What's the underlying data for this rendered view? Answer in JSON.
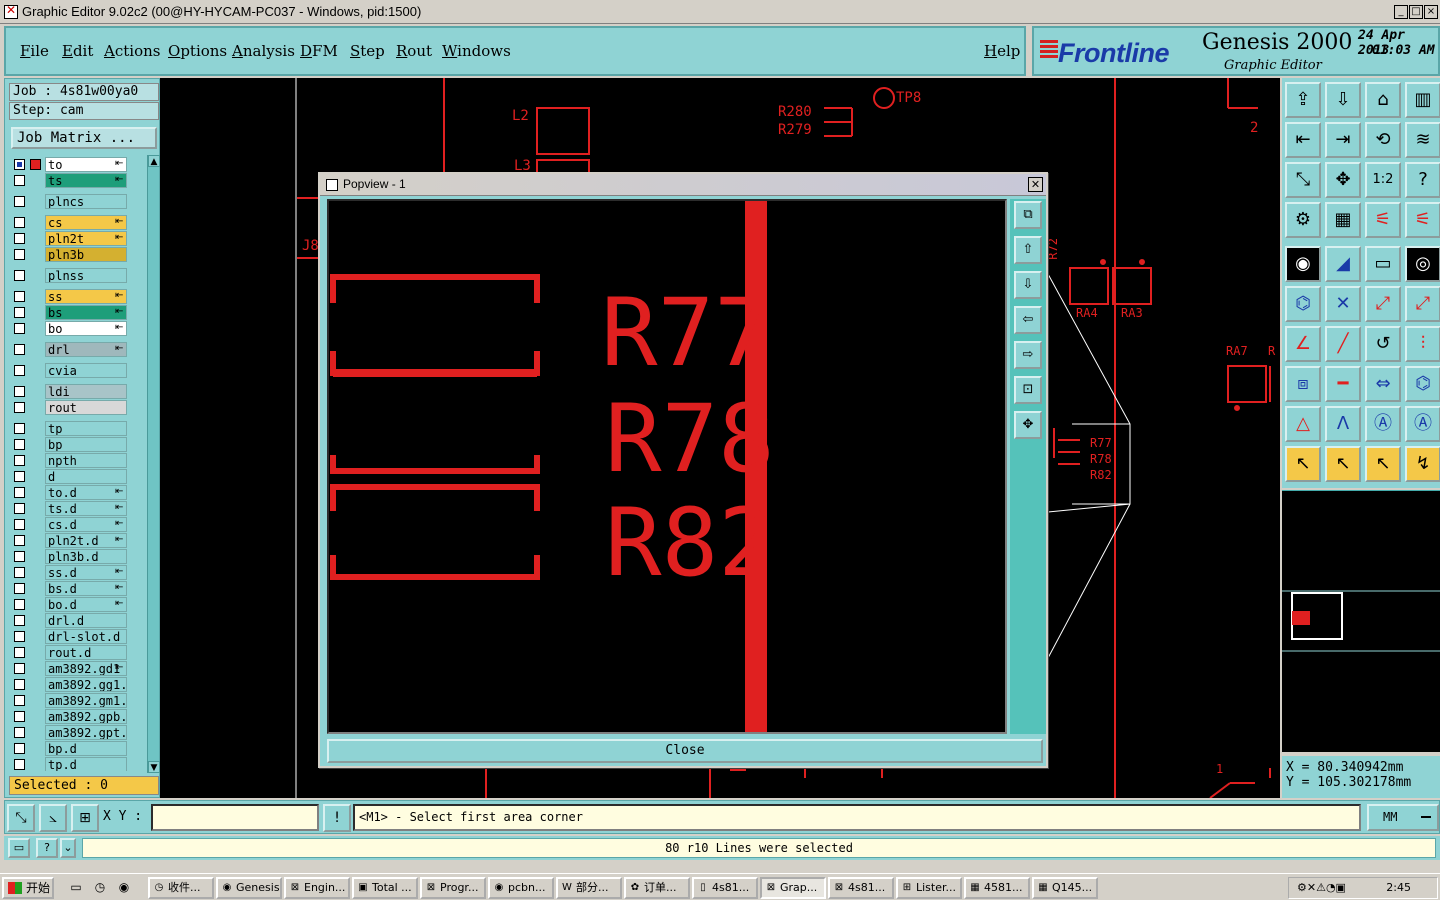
{
  "window": {
    "title": "Graphic Editor 9.02c2 (00@HY-HYCAM-PC037 - Windows, pid:1500)",
    "controls": [
      "_",
      "□",
      "×"
    ]
  },
  "menu": {
    "items": [
      "File",
      "Edit",
      "Actions",
      "Options",
      "Analysis",
      "DFM",
      "Step",
      "Rout",
      "Windows"
    ],
    "help": "Help"
  },
  "brand": {
    "logo": "Frontline",
    "product": "Genesis 2000",
    "subtitle": "Graphic Editor",
    "date": "24 Apr 2013",
    "time": "01:03 AM"
  },
  "left_panel": {
    "job": "Job : 4s81w00ya0",
    "step": "Step: cam",
    "job_matrix": "Job Matrix ...",
    "layers": [
      {
        "name": "to",
        "color": "#ffffff",
        "mark": "⇤"
      },
      {
        "name": "ts",
        "color": "#1e9e7a",
        "mark": "⇤"
      },
      {
        "name": "plncs",
        "color": "#8fd3d4",
        "mark": ""
      },
      {
        "name": "cs",
        "color": "#f4c848",
        "mark": "⇤"
      },
      {
        "name": "pln2t",
        "color": "#f4c848",
        "mark": "⇤"
      },
      {
        "name": "pln3b",
        "color": "#d4b030",
        "mark": ""
      },
      {
        "name": "plnss",
        "color": "#8fd3d4",
        "mark": ""
      },
      {
        "name": "ss",
        "color": "#f4c848",
        "mark": "⇤"
      },
      {
        "name": "bs",
        "color": "#1e9e7a",
        "mark": "⇤"
      },
      {
        "name": "bo",
        "color": "#ffffff",
        "mark": "⇤"
      },
      {
        "name": "drl",
        "color": "#9fb8bc",
        "mark": "⇤"
      },
      {
        "name": "cvia",
        "color": "#8fd3d4",
        "mark": ""
      },
      {
        "name": "ldi",
        "color": "#a8c4c8",
        "mark": ""
      },
      {
        "name": "rout",
        "color": "#d8d8d8",
        "mark": ""
      },
      {
        "name": "tp",
        "color": "#8fd3d4",
        "mark": ""
      },
      {
        "name": "bp",
        "color": "#8fd3d4",
        "mark": ""
      },
      {
        "name": "npth",
        "color": "#8fd3d4",
        "mark": ""
      },
      {
        "name": "d",
        "color": "#8fd3d4",
        "mark": ""
      },
      {
        "name": "to.d",
        "color": "#8fd3d4",
        "mark": "⇤"
      },
      {
        "name": "ts.d",
        "color": "#8fd3d4",
        "mark": "⇤"
      },
      {
        "name": "cs.d",
        "color": "#8fd3d4",
        "mark": "⇤"
      },
      {
        "name": "pln2t.d",
        "color": "#8fd3d4",
        "mark": "⇤"
      },
      {
        "name": "pln3b.d",
        "color": "#8fd3d4",
        "mark": ""
      },
      {
        "name": "ss.d",
        "color": "#8fd3d4",
        "mark": "⇤"
      },
      {
        "name": "bs.d",
        "color": "#8fd3d4",
        "mark": "⇤"
      },
      {
        "name": "bo.d",
        "color": "#8fd3d4",
        "mark": "⇤"
      },
      {
        "name": "drl.d",
        "color": "#8fd3d4",
        "mark": ""
      },
      {
        "name": "drl-slot.d",
        "color": "#8fd3d4",
        "mark": ""
      },
      {
        "name": "rout.d",
        "color": "#8fd3d4",
        "mark": ""
      },
      {
        "name": "am3892.gd1",
        "color": "#8fd3d4",
        "mark": "⇤"
      },
      {
        "name": "am3892.gg1.",
        "color": "#8fd3d4",
        "mark": ""
      },
      {
        "name": "am3892.gm1.",
        "color": "#8fd3d4",
        "mark": ""
      },
      {
        "name": "am3892.gpb.",
        "color": "#8fd3d4",
        "mark": ""
      },
      {
        "name": "am3892.gpt.",
        "color": "#8fd3d4",
        "mark": ""
      },
      {
        "name": "bp.d",
        "color": "#8fd3d4",
        "mark": ""
      },
      {
        "name": "tp.d",
        "color": "#8fd3d4",
        "mark": ""
      }
    ],
    "selected": "Selected : 0"
  },
  "canvas": {
    "labels": {
      "l2": "L2",
      "l3": "L3",
      "r280": "R280",
      "r279": "R279",
      "tp8": "TP8",
      "j8": "J8",
      "r72": "R72",
      "ra4": "RA4",
      "ra3": "RA3",
      "ra7": "RA7",
      "r": "R",
      "r77": "R77",
      "r78": "R78",
      "r82": "R82",
      "two": "2",
      "one": "1"
    }
  },
  "popview": {
    "title": "Popview - 1",
    "labels": [
      "R77",
      "R78",
      "R82"
    ],
    "close": "Close",
    "tools": [
      "⧉",
      "⇧",
      "⇩",
      "⇦",
      "⇨",
      "⊡",
      "✥"
    ]
  },
  "right_tools": {
    "rows": [
      [
        "⇪",
        "⇩",
        "⌂",
        "▥"
      ],
      [
        "⇤",
        "⇥",
        "⟲",
        "≋"
      ],
      [
        "⤡",
        "✥",
        "1:2",
        "?"
      ],
      [
        "⚙",
        "▦",
        "⚟",
        "⚟"
      ],
      [
        "◉",
        "◢",
        "▭",
        "◎"
      ],
      [
        "⌬",
        "✕",
        "⤢",
        "⤢"
      ],
      [
        "∠",
        "╱",
        "↺",
        "⫶"
      ],
      [
        "⧈",
        "━",
        "⇔",
        "⌬"
      ],
      [
        "△",
        "Λ",
        "Ⓐ",
        "Ⓐ"
      ],
      [
        "↖",
        "↖",
        "↖",
        "↯"
      ]
    ]
  },
  "coords": {
    "x": "X = 80.340942mm",
    "y": "Y = 105.302178mm"
  },
  "bottom": {
    "xy_label": "X Y :",
    "xy_value": "",
    "bang": "!",
    "prompt": "<M1> - Select first area corner",
    "unit": "MM",
    "status": "80 r10 Lines were selected",
    "mini_buttons": [
      "▭",
      "?",
      "⌄"
    ]
  },
  "taskbar": {
    "start": "开始",
    "tasks": [
      {
        "label": "收件...",
        "icon": "◷"
      },
      {
        "label": "Genesis",
        "icon": "◉"
      },
      {
        "label": "Engin...",
        "icon": "⊠"
      },
      {
        "label": "Total ...",
        "icon": "▣"
      },
      {
        "label": "Progr...",
        "icon": "⊠"
      },
      {
        "label": "pcbn...",
        "icon": "◉"
      },
      {
        "label": "部分...",
        "icon": "W"
      },
      {
        "label": "订单...",
        "icon": "✿"
      },
      {
        "label": "4s81...",
        "icon": "▯"
      },
      {
        "label": "Grap...",
        "icon": "⊠"
      },
      {
        "label": "4s81...",
        "icon": "⊠"
      },
      {
        "label": "Lister...",
        "icon": "⊞"
      },
      {
        "label": "4581...",
        "icon": "▦"
      },
      {
        "label": "Q145...",
        "icon": "▦"
      }
    ],
    "active_task": "Grap...",
    "clock": "2:45"
  }
}
